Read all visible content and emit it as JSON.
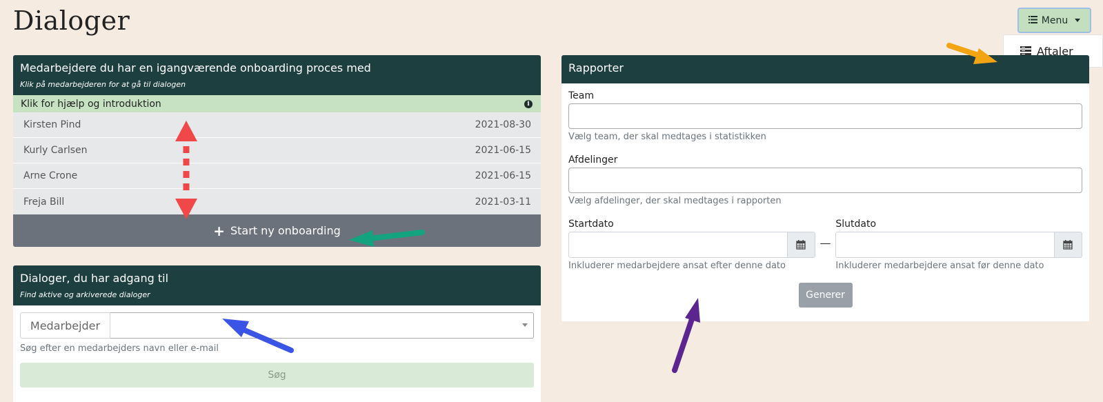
{
  "page": {
    "title": "Dialoger"
  },
  "menu": {
    "button_label": "Menu",
    "dropdown_items": [
      {
        "label": "Aftaler",
        "icon": "list-icon"
      }
    ]
  },
  "onboarding": {
    "title": "Medarbejdere du har en igangværende onboarding proces med",
    "subtitle": "Klik på medarbejderen for at gå til dialogen",
    "help_label": "Klik for hjælp og introduktion",
    "employees": [
      {
        "name": "Kirsten Pind",
        "date": "2021-08-30"
      },
      {
        "name": "Kurly Carlsen",
        "date": "2021-06-15"
      },
      {
        "name": "Arne Crone",
        "date": "2021-06-15"
      },
      {
        "name": "Freja Bill",
        "date": "2021-03-11"
      }
    ],
    "start_label": "Start ny onboarding"
  },
  "dialogs": {
    "title": "Dialoger, du har adgang til",
    "subtitle": "Find aktive og arkiverede dialoger",
    "search_addon": "Medarbejder",
    "search_value": "",
    "search_hint": "Søg efter en medarbejders navn eller e-mail",
    "search_button": "Søg"
  },
  "reports": {
    "title": "Rapporter",
    "team_label": "Team",
    "team_value": "",
    "team_hint": "Vælg team, der skal medtages i statistikken",
    "departments_label": "Afdelinger",
    "departments_value": "",
    "departments_hint": "Vælg afdelinger, der skal medtages i rapporten",
    "start_label": "Startdato",
    "start_value": "",
    "start_hint": "Inkluderer medarbejdere ansat efter denne dato",
    "separator": "—",
    "end_label": "Slutdato",
    "end_value": "",
    "end_hint": "Inkluderer medarbejdere ansat før denne dato",
    "generate_label": "Generer"
  },
  "colors": {
    "background": "#f5ebe0",
    "header": "#1d3f40",
    "help_row": "#c6e2c3",
    "menu_button": "#c3dfc0",
    "arrow_red": "#f04848",
    "arrow_green": "#14a37f",
    "arrow_blue": "#3a55e6",
    "arrow_purple": "#5b2590",
    "arrow_orange": "#f2a413"
  }
}
